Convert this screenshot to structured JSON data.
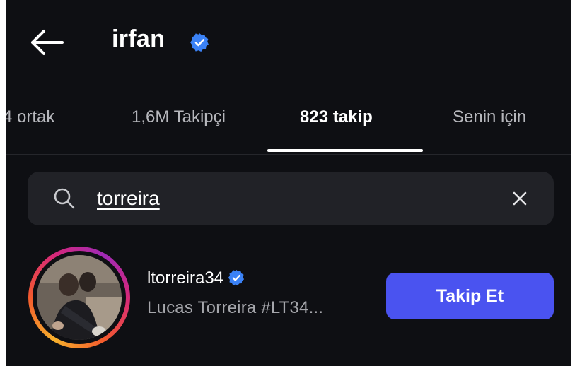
{
  "header": {
    "username": "irfan",
    "verified": true,
    "back_icon": "arrow-left-icon"
  },
  "tabs": [
    {
      "label": "4 ortak",
      "active": false
    },
    {
      "label": "1,6M Takipçi",
      "active": false
    },
    {
      "label": "823 takip",
      "active": true
    },
    {
      "label": "Senin için",
      "active": false
    }
  ],
  "search": {
    "value": "torreira",
    "icon": "search-icon",
    "clear_icon": "close-icon"
  },
  "results": [
    {
      "handle": "ltorreira34",
      "verified": true,
      "full_name": "Lucas Torreira #LT34...",
      "button_label": "Takip Et",
      "has_story_ring": true
    }
  ],
  "colors": {
    "background": "#0e0f13",
    "search_field": "#212227",
    "accent_button": "#4a53f0",
    "verified_badge": "#3b82f6",
    "secondary_text": "#a5a6ab"
  }
}
